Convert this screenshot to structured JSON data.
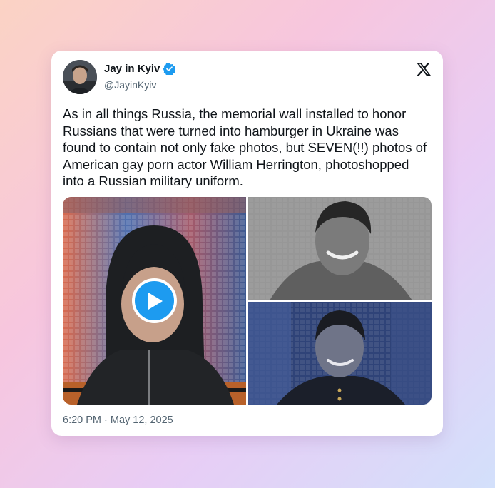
{
  "tweet": {
    "display_name": "Jay in Kyiv",
    "handle": "@JayinKyiv",
    "verified": true,
    "text": "As in all things Russia, the memorial wall installed to honor Russians that were turned into hamburger in Ukraine was found to contain not only fake photos, but SEVEN(!!) photos of American gay porn actor William Herrington, photoshopped into a Russian military uniform.",
    "timestamp": "6:20 PM · May 12, 2025",
    "media": [
      {
        "kind": "video",
        "icon": "play-icon"
      },
      {
        "kind": "photo"
      },
      {
        "kind": "photo"
      }
    ]
  },
  "icons": {
    "brand": "x-logo-icon",
    "verified": "verified-badge-icon"
  },
  "colors": {
    "accent": "#1d9bf0",
    "text": "#0f1419",
    "muted": "#536471",
    "card": "#ffffff"
  }
}
